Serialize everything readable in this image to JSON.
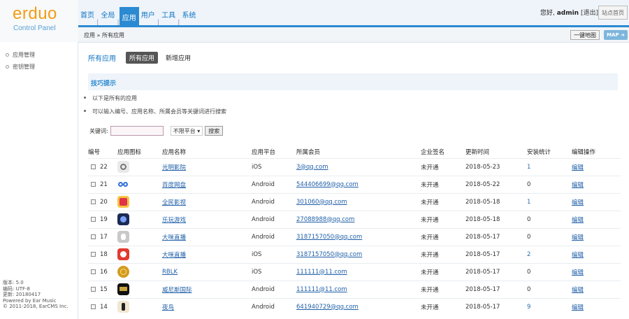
{
  "logo": {
    "text": "erduo",
    "subtitle": "Control Panel"
  },
  "nav": {
    "items": [
      "首页",
      "全局",
      "应用",
      "用户",
      "工具",
      "系统"
    ],
    "active_index": 2
  },
  "user": {
    "greeting": "您好,",
    "name": "admin",
    "logout": "[退出]",
    "home_button": "站点首页"
  },
  "breadcrumb": {
    "text": "应用 » 所有应用",
    "quick_map_label": "一键地图",
    "map_label": "MAP"
  },
  "sidebar": {
    "items": [
      "应用管理",
      "密钥管理"
    ],
    "footer": [
      "版本: 5.0",
      "编码: UTF-8",
      "更新: 20180417",
      "Powered by Ear Music",
      "© 2011-2018, EarCMS Inc."
    ]
  },
  "tabs": {
    "title": "所有应用",
    "items": [
      "所有应用",
      "新增应用"
    ],
    "active_index": 0
  },
  "tips": {
    "title": "技巧提示",
    "lines": [
      "以下是所有的应用",
      "可以输入编号、应用名称、所属会员等关键词进行搜索"
    ]
  },
  "search": {
    "label": "关键词:",
    "input_value": "",
    "platform_select": "不限平台",
    "button_label": "搜索"
  },
  "table": {
    "columns": [
      "编号",
      "应用图标",
      "应用名称",
      "应用平台",
      "所属会员",
      "企业签名",
      "更新时间",
      "安装统计",
      "编辑操作"
    ],
    "rows": [
      {
        "id": "22",
        "name": "光明影院",
        "platform": "iOS",
        "member": "3@qq.com",
        "sign": "未开通",
        "date": "2018-05-23",
        "installs": "1",
        "action": "编辑",
        "icon": "camera-icon"
      },
      {
        "id": "21",
        "name": "百度网盘",
        "platform": "Android",
        "member": "544406699@qq.com",
        "sign": "未开通",
        "date": "2018-05-22",
        "installs": "0",
        "action": "编辑",
        "icon": "cloud-icon"
      },
      {
        "id": "20",
        "name": "全民影视",
        "platform": "Android",
        "member": "301060@qq.com",
        "sign": "未开通",
        "date": "2018-05-18",
        "installs": "1",
        "action": "编辑",
        "icon": "video-icon"
      },
      {
        "id": "19",
        "name": "乐玩游戏",
        "platform": "Android",
        "member": "27088988@qq.com",
        "sign": "未开通",
        "date": "2018-05-18",
        "installs": "0",
        "action": "编辑",
        "icon": "game-icon"
      },
      {
        "id": "17",
        "name": "大咪直播",
        "platform": "Android",
        "member": "3187157050@qq.com",
        "sign": "未开通",
        "date": "2018-05-17",
        "installs": "0",
        "action": "编辑",
        "icon": "android-icon"
      },
      {
        "id": "18",
        "name": "大咪直播",
        "platform": "iOS",
        "member": "3187157050@qq.com",
        "sign": "未开通",
        "date": "2018-05-17",
        "installs": "2",
        "action": "编辑",
        "icon": "live-icon"
      },
      {
        "id": "16",
        "name": "RBLK",
        "platform": "iOS",
        "member": "111111@11.com",
        "sign": "未开通",
        "date": "2018-05-17",
        "installs": "0",
        "action": "编辑",
        "icon": "coin-icon"
      },
      {
        "id": "15",
        "name": "威尼斯国际",
        "platform": "Android",
        "member": "111111@11.com",
        "sign": "未开通",
        "date": "2018-05-17",
        "installs": "0",
        "action": "编辑",
        "icon": "casino-icon"
      },
      {
        "id": "14",
        "name": "夜鸟",
        "platform": "Android",
        "member": "641940729@qq.com",
        "sign": "未开通",
        "date": "2018-05-17",
        "installs": "9",
        "action": "编辑",
        "icon": "bird-icon"
      }
    ]
  },
  "colors": {
    "accent": "#2b8ad1",
    "logo": "#f39c12",
    "link": "#1f5fa8"
  }
}
